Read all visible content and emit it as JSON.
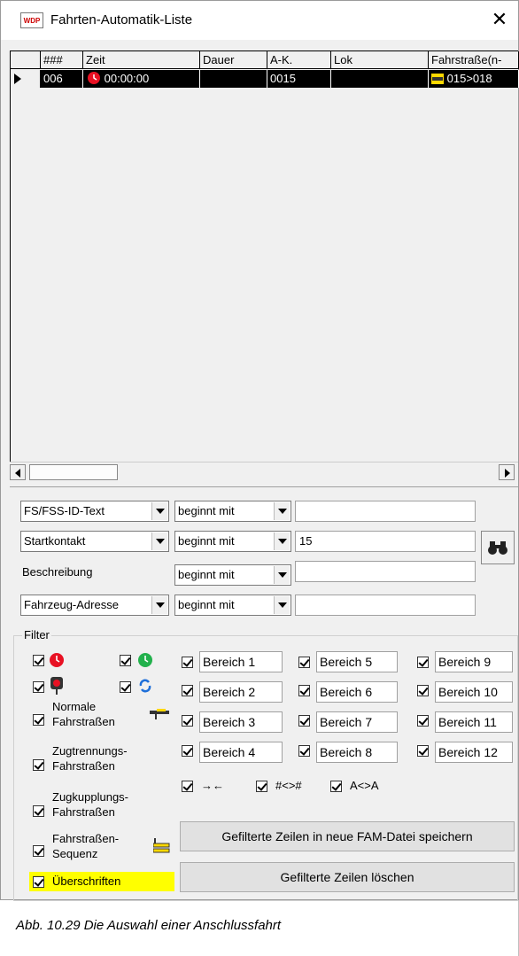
{
  "window": {
    "title": "Fahrten-Automatik-Liste",
    "icon_text": "WDP",
    "close_label": "✕"
  },
  "grid": {
    "columns": [
      "###",
      "Zeit",
      "Dauer",
      "A-K.",
      "Lok",
      "Fahrstraße(n-"
    ],
    "rows": [
      [
        "006",
        "00:00:00",
        "",
        "0015",
        "",
        "015>018"
      ]
    ]
  },
  "search": {
    "rows": [
      {
        "field": "FS/FSS-ID-Text",
        "op": "beginnt mit",
        "value": ""
      },
      {
        "field": "Startkontakt",
        "op": "beginnt mit",
        "value": "15"
      },
      {
        "field": "Beschreibung",
        "op": "beginnt mit",
        "value": ""
      },
      {
        "field": "Fahrzeug-Adresse",
        "op": "beginnt mit",
        "value": ""
      }
    ]
  },
  "filter": {
    "title": "Filter",
    "labels": {
      "normale": [
        "Normale",
        "Fahrstraßen"
      ],
      "zugtrennung": [
        "Zugtrennungs-",
        "Fahrstraßen"
      ],
      "zugkupplung": [
        "Zugkupplungs-",
        "Fahrstraßen"
      ],
      "sequenz": [
        "Fahrstraßen-",
        "Sequenz"
      ],
      "ueberschriften": "Überschriften"
    },
    "bereiche": [
      "Bereich 1",
      "Bereich 2",
      "Bereich 3",
      "Bereich 4",
      "Bereich 5",
      "Bereich 6",
      "Bereich 7",
      "Bereich 8",
      "Bereich 9",
      "Bereich 10",
      "Bereich 11",
      "Bereich 12"
    ],
    "options": [
      "→←",
      "#<>#",
      "A<>A"
    ]
  },
  "buttons": {
    "save": "Gefilterte Zeilen in neue FAM-Datei speichern",
    "delete": "Gefilterte Zeilen löschen"
  },
  "caption": "Abb. 10.29  Die Auswahl einer Anschlussfahrt",
  "colors": {
    "highlight": "#ffff00",
    "red_icon": "#e81123",
    "green_icon": "#22b14c"
  }
}
